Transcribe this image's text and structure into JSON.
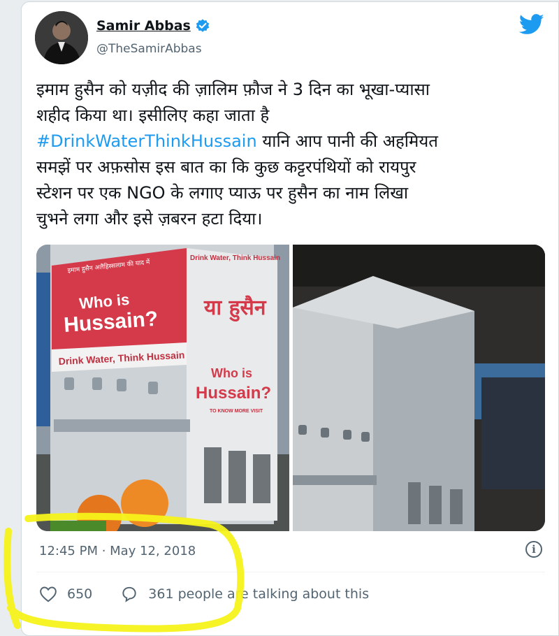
{
  "author": {
    "name": "Samir Abbas",
    "handle": "@TheSamirAbbas",
    "verified": true
  },
  "tweet": {
    "lines": [
      "इमाम हुसैन को यज़ीद की ज़ालिम फ़ौज ने 3 दिन का भूखा-प्यासा",
      "शहीद किया था। इसीलिए कहा जाता है"
    ],
    "hashtag": "#DrinkWaterThinkHussain",
    "after_hashtag": " यानि आप पानी की अहमियत",
    "more_lines": [
      "समझें पर अफ़सोस इस बात का कि कुछ कट्टरपंथियों को रायपुर",
      "स्टेशन पर एक NGO के लगाए प्याऊ पर हुसैन का नाम लिखा",
      "चुभने लगा और इसे ज़बरन हटा दिया।"
    ]
  },
  "photo_left": {
    "banner_top": "इमाम हुसैन अलैहिस्सलाम की याद में",
    "headline_line1": "Who is",
    "headline_line2": "Hussain?",
    "strip": "Drink Water, Think Hussain",
    "side_top": "Drink Water, Think Hussain",
    "side_hindi": "या हुसैन",
    "side_line1": "Who is",
    "side_line2": "Hussain?",
    "side_small": "TO KNOW MORE VISIT"
  },
  "timestamp": "12:45 PM · May 12, 2018",
  "likes": "650",
  "talking": "361 people are talking about this",
  "colors": {
    "link": "#1d9bf0",
    "twitter": "#1d9bf0",
    "highlight": "#f6f21a",
    "panel_red": "#d43a4a"
  }
}
